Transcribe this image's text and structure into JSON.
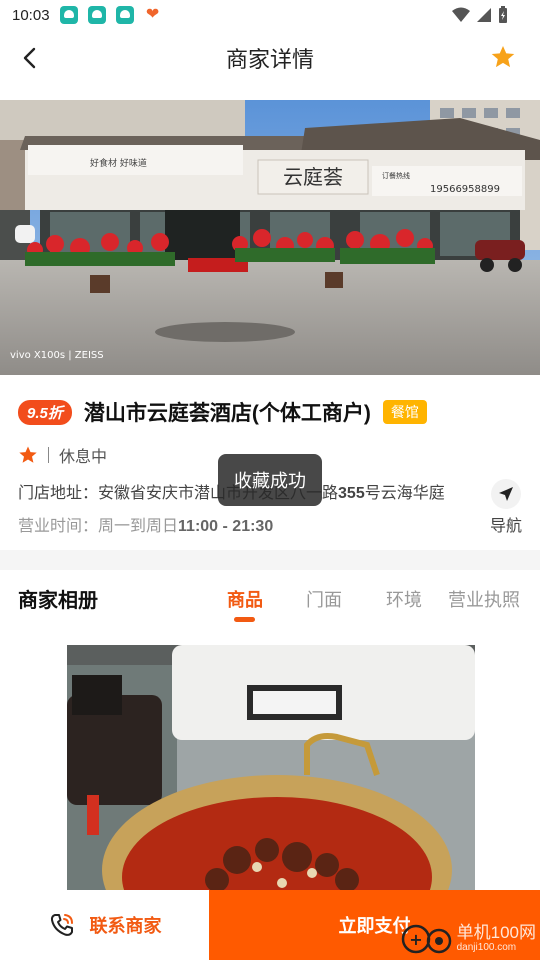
{
  "status_bar": {
    "time": "10:03"
  },
  "header": {
    "title": "商家详情"
  },
  "shop": {
    "discount": "9.5折",
    "name": "潜山市云庭荟酒店(个体工商户)",
    "category": "餐馆",
    "status": "休息中",
    "address_label": "门店地址：",
    "address_value_pre": "安徽省安庆市潜山市开发区八一路",
    "address_value_num": "355",
    "address_value_post": "号云海华庭",
    "hours_label": "营业时间：",
    "hours_days": "周一到周日",
    "hours_time": "11:00 - 21:30",
    "nav_label": "导航"
  },
  "hero_photo": {
    "sign_name": "云庭荟",
    "sign_left": "好食材  好味道",
    "sign_phone_label": "订餐热线",
    "sign_phone": "19566958899",
    "camera_mark": "vivo X100s | ZEISS"
  },
  "album": {
    "title": "商家相册",
    "tabs": [
      {
        "label": "商品",
        "active": true
      },
      {
        "label": "门面",
        "active": false
      },
      {
        "label": "环境",
        "active": false
      },
      {
        "label": "营业执照",
        "active": false
      }
    ]
  },
  "toast": {
    "text": "收藏成功"
  },
  "bottom_bar": {
    "contact_label": "联系商家",
    "pay_label": "立即支付"
  },
  "watermark": {
    "title": "单机100网",
    "url": "danji100.com"
  },
  "colors": {
    "accent": "#ff5a00",
    "badge_discount": "#f24d1c",
    "badge_category": "#ffb400",
    "star": "#f7a21a"
  }
}
